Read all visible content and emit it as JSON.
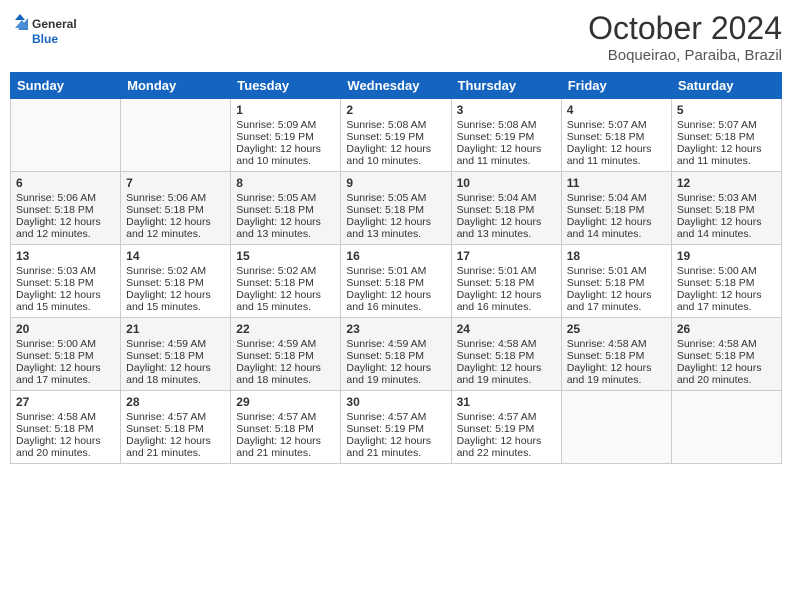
{
  "header": {
    "logo": {
      "general": "General",
      "blue": "Blue"
    },
    "title": "October 2024",
    "location": "Boqueirao, Paraiba, Brazil"
  },
  "days_of_week": [
    "Sunday",
    "Monday",
    "Tuesday",
    "Wednesday",
    "Thursday",
    "Friday",
    "Saturday"
  ],
  "weeks": [
    [
      {
        "day": "",
        "sunrise": "",
        "sunset": "",
        "daylight": ""
      },
      {
        "day": "",
        "sunrise": "",
        "sunset": "",
        "daylight": ""
      },
      {
        "day": "1",
        "sunrise": "Sunrise: 5:09 AM",
        "sunset": "Sunset: 5:19 PM",
        "daylight": "Daylight: 12 hours and 10 minutes."
      },
      {
        "day": "2",
        "sunrise": "Sunrise: 5:08 AM",
        "sunset": "Sunset: 5:19 PM",
        "daylight": "Daylight: 12 hours and 10 minutes."
      },
      {
        "day": "3",
        "sunrise": "Sunrise: 5:08 AM",
        "sunset": "Sunset: 5:19 PM",
        "daylight": "Daylight: 12 hours and 11 minutes."
      },
      {
        "day": "4",
        "sunrise": "Sunrise: 5:07 AM",
        "sunset": "Sunset: 5:18 PM",
        "daylight": "Daylight: 12 hours and 11 minutes."
      },
      {
        "day": "5",
        "sunrise": "Sunrise: 5:07 AM",
        "sunset": "Sunset: 5:18 PM",
        "daylight": "Daylight: 12 hours and 11 minutes."
      }
    ],
    [
      {
        "day": "6",
        "sunrise": "Sunrise: 5:06 AM",
        "sunset": "Sunset: 5:18 PM",
        "daylight": "Daylight: 12 hours and 12 minutes."
      },
      {
        "day": "7",
        "sunrise": "Sunrise: 5:06 AM",
        "sunset": "Sunset: 5:18 PM",
        "daylight": "Daylight: 12 hours and 12 minutes."
      },
      {
        "day": "8",
        "sunrise": "Sunrise: 5:05 AM",
        "sunset": "Sunset: 5:18 PM",
        "daylight": "Daylight: 12 hours and 13 minutes."
      },
      {
        "day": "9",
        "sunrise": "Sunrise: 5:05 AM",
        "sunset": "Sunset: 5:18 PM",
        "daylight": "Daylight: 12 hours and 13 minutes."
      },
      {
        "day": "10",
        "sunrise": "Sunrise: 5:04 AM",
        "sunset": "Sunset: 5:18 PM",
        "daylight": "Daylight: 12 hours and 13 minutes."
      },
      {
        "day": "11",
        "sunrise": "Sunrise: 5:04 AM",
        "sunset": "Sunset: 5:18 PM",
        "daylight": "Daylight: 12 hours and 14 minutes."
      },
      {
        "day": "12",
        "sunrise": "Sunrise: 5:03 AM",
        "sunset": "Sunset: 5:18 PM",
        "daylight": "Daylight: 12 hours and 14 minutes."
      }
    ],
    [
      {
        "day": "13",
        "sunrise": "Sunrise: 5:03 AM",
        "sunset": "Sunset: 5:18 PM",
        "daylight": "Daylight: 12 hours and 15 minutes."
      },
      {
        "day": "14",
        "sunrise": "Sunrise: 5:02 AM",
        "sunset": "Sunset: 5:18 PM",
        "daylight": "Daylight: 12 hours and 15 minutes."
      },
      {
        "day": "15",
        "sunrise": "Sunrise: 5:02 AM",
        "sunset": "Sunset: 5:18 PM",
        "daylight": "Daylight: 12 hours and 15 minutes."
      },
      {
        "day": "16",
        "sunrise": "Sunrise: 5:01 AM",
        "sunset": "Sunset: 5:18 PM",
        "daylight": "Daylight: 12 hours and 16 minutes."
      },
      {
        "day": "17",
        "sunrise": "Sunrise: 5:01 AM",
        "sunset": "Sunset: 5:18 PM",
        "daylight": "Daylight: 12 hours and 16 minutes."
      },
      {
        "day": "18",
        "sunrise": "Sunrise: 5:01 AM",
        "sunset": "Sunset: 5:18 PM",
        "daylight": "Daylight: 12 hours and 17 minutes."
      },
      {
        "day": "19",
        "sunrise": "Sunrise: 5:00 AM",
        "sunset": "Sunset: 5:18 PM",
        "daylight": "Daylight: 12 hours and 17 minutes."
      }
    ],
    [
      {
        "day": "20",
        "sunrise": "Sunrise: 5:00 AM",
        "sunset": "Sunset: 5:18 PM",
        "daylight": "Daylight: 12 hours and 17 minutes."
      },
      {
        "day": "21",
        "sunrise": "Sunrise: 4:59 AM",
        "sunset": "Sunset: 5:18 PM",
        "daylight": "Daylight: 12 hours and 18 minutes."
      },
      {
        "day": "22",
        "sunrise": "Sunrise: 4:59 AM",
        "sunset": "Sunset: 5:18 PM",
        "daylight": "Daylight: 12 hours and 18 minutes."
      },
      {
        "day": "23",
        "sunrise": "Sunrise: 4:59 AM",
        "sunset": "Sunset: 5:18 PM",
        "daylight": "Daylight: 12 hours and 19 minutes."
      },
      {
        "day": "24",
        "sunrise": "Sunrise: 4:58 AM",
        "sunset": "Sunset: 5:18 PM",
        "daylight": "Daylight: 12 hours and 19 minutes."
      },
      {
        "day": "25",
        "sunrise": "Sunrise: 4:58 AM",
        "sunset": "Sunset: 5:18 PM",
        "daylight": "Daylight: 12 hours and 19 minutes."
      },
      {
        "day": "26",
        "sunrise": "Sunrise: 4:58 AM",
        "sunset": "Sunset: 5:18 PM",
        "daylight": "Daylight: 12 hours and 20 minutes."
      }
    ],
    [
      {
        "day": "27",
        "sunrise": "Sunrise: 4:58 AM",
        "sunset": "Sunset: 5:18 PM",
        "daylight": "Daylight: 12 hours and 20 minutes."
      },
      {
        "day": "28",
        "sunrise": "Sunrise: 4:57 AM",
        "sunset": "Sunset: 5:18 PM",
        "daylight": "Daylight: 12 hours and 21 minutes."
      },
      {
        "day": "29",
        "sunrise": "Sunrise: 4:57 AM",
        "sunset": "Sunset: 5:18 PM",
        "daylight": "Daylight: 12 hours and 21 minutes."
      },
      {
        "day": "30",
        "sunrise": "Sunrise: 4:57 AM",
        "sunset": "Sunset: 5:19 PM",
        "daylight": "Daylight: 12 hours and 21 minutes."
      },
      {
        "day": "31",
        "sunrise": "Sunrise: 4:57 AM",
        "sunset": "Sunset: 5:19 PM",
        "daylight": "Daylight: 12 hours and 22 minutes."
      },
      {
        "day": "",
        "sunrise": "",
        "sunset": "",
        "daylight": ""
      },
      {
        "day": "",
        "sunrise": "",
        "sunset": "",
        "daylight": ""
      }
    ]
  ]
}
